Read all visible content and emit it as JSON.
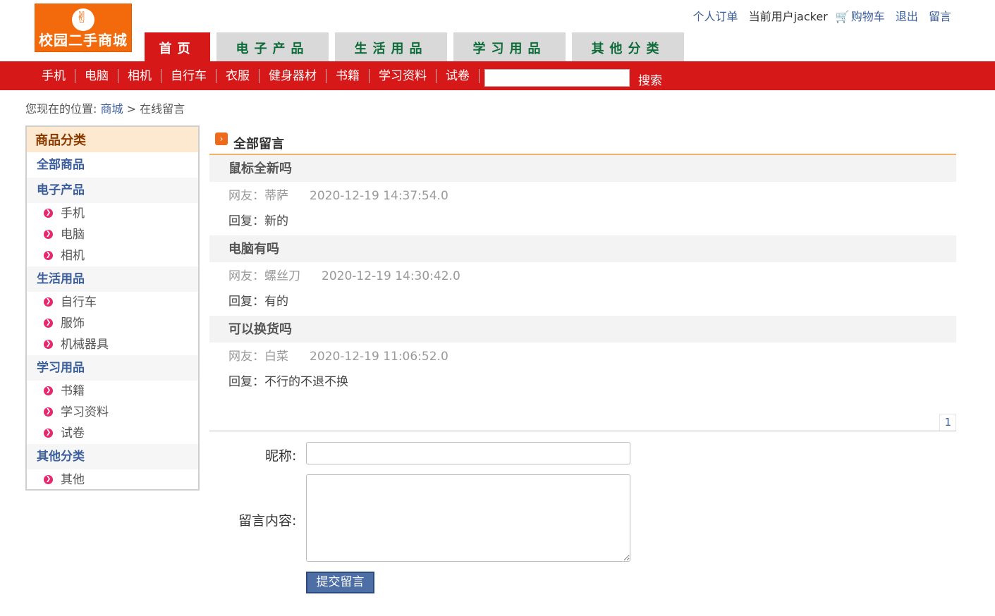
{
  "header": {
    "logo_text": "校园二手商城",
    "my_orders": "个人订单",
    "current_user": "当前用户jacker",
    "cart": "购物车",
    "logout": "退出",
    "messages": "留言"
  },
  "nav": {
    "tabs": [
      {
        "label": "首页",
        "active": true
      },
      {
        "label": "电子产品"
      },
      {
        "label": "生活用品"
      },
      {
        "label": "学习用品"
      },
      {
        "label": "其他分类"
      }
    ],
    "subnav": [
      "手机",
      "电脑",
      "相机",
      "自行车",
      "衣服",
      "健身器材",
      "书籍",
      "学习资料",
      "试卷"
    ],
    "search_label": "搜索",
    "search_value": ""
  },
  "breadcrumb": {
    "prefix": "您现在的位置:",
    "home": "商城",
    "separator": ">",
    "current": "在线留言"
  },
  "sidebar": {
    "title": "商品分类",
    "all": "全部商品",
    "groups": [
      {
        "name": "电子产品",
        "items": [
          "手机",
          "电脑",
          "相机"
        ]
      },
      {
        "name": "生活用品",
        "items": [
          "自行车",
          "服饰",
          "机械器具"
        ]
      },
      {
        "name": "学习用品",
        "items": [
          "书籍",
          "学习资料",
          "试卷"
        ]
      },
      {
        "name": "其他分类",
        "items": [
          "其他"
        ]
      }
    ]
  },
  "main": {
    "title": "全部留言",
    "messages": [
      {
        "title": "鼠标全新吗",
        "author": "网友：蒂萨",
        "time": "2020-12-19 14:37:54.0",
        "reply": "回复：新的"
      },
      {
        "title": "电脑有吗",
        "author": "网友：螺丝刀",
        "time": "2020-12-19 14:30:42.0",
        "reply": "回复：有的"
      },
      {
        "title": "可以换货吗",
        "author": "网友：白菜",
        "time": "2020-12-19 11:06:52.0",
        "reply": "回复：不行的不退不换"
      }
    ],
    "page": "1"
  },
  "form": {
    "nickname_label": "昵称:",
    "nickname_value": "",
    "content_label": "留言内容:",
    "content_value": "",
    "submit_label": "提交留言"
  },
  "colors": {
    "brand_red": "#d71818",
    "logo_orange": "#f26a0c",
    "tab_green": "#0e6b3a",
    "link_blue": "#3b5e9c"
  }
}
